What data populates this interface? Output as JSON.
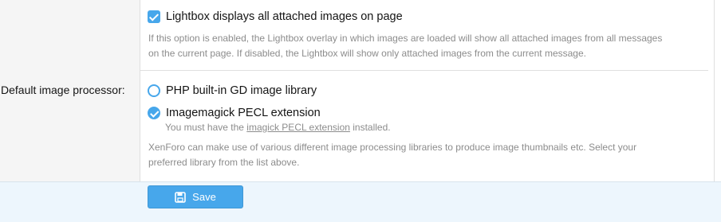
{
  "lightbox": {
    "label": "Lightbox displays all attached images on page",
    "checked": true,
    "hint_line1": "If this option is enabled, the Lightbox overlay in which images are loaded will show all attached images from all messages",
    "hint_line2": "on the current page. If disabled, the Lightbox will show only attached images from the current message."
  },
  "image_processor": {
    "label": "Default image processor:",
    "options": [
      {
        "label": "PHP built-in GD image library",
        "selected": false
      },
      {
        "label": "Imagemagick PECL extension",
        "selected": true
      }
    ],
    "imagick_hint_prefix": "You must have the ",
    "imagick_hint_link": "imagick PECL extension",
    "imagick_hint_suffix": " installed.",
    "explain_line1": "XenForo can make use of various different image processing libraries to produce image thumbnails etc. Select your",
    "explain_line2": "preferred library from the list above."
  },
  "footer": {
    "save_label": "Save",
    "save_icon": "save-icon"
  },
  "colors": {
    "accent": "#47a7eb",
    "footer_bg": "#edf6fd",
    "label_col_bg": "#f5f5f5",
    "hint_text": "#8c8c8c"
  }
}
